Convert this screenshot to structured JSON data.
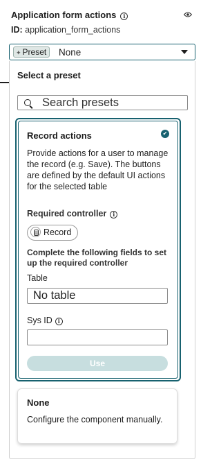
{
  "header": {
    "title": "Application form actions",
    "id_label": "ID:",
    "id_value": "application_form_actions"
  },
  "selector": {
    "pill_label": "Preset",
    "value": "None"
  },
  "panel": {
    "title": "Select a preset",
    "search_placeholder": "Search presets"
  },
  "presets": [
    {
      "title": "Record actions",
      "selected": true,
      "description": "Provide actions for a user to manage the record (e.g. Save). The buttons are defined by the default UI actions for the selected table",
      "required_controller_label": "Required controller",
      "controller_chip": "Record",
      "follow_text": "Complete the following fields to set up the required controller",
      "table_label": "Table",
      "table_value": "No table",
      "sysid_label": "Sys ID",
      "sysid_value": "",
      "button_label": "Use"
    },
    {
      "title": "None",
      "description": "Configure the component manually."
    }
  ],
  "colors": {
    "accent": "#17616f",
    "button_disabled": "#c7dedf"
  }
}
